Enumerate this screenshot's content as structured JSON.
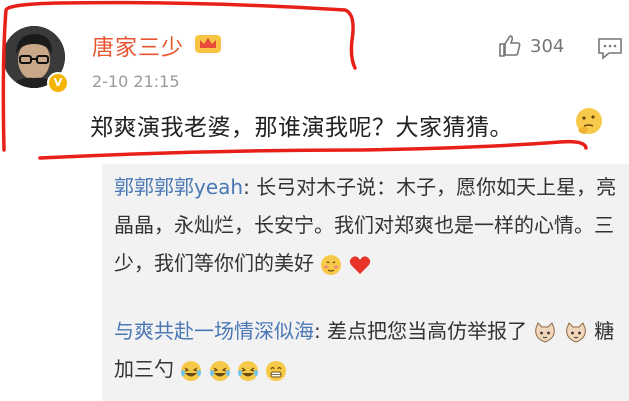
{
  "post": {
    "username": "唐家三少",
    "time": "2-10 21:15",
    "likes": "304",
    "text": "郑爽演我老婆，那谁演我呢？大家猜猜。",
    "icons": [
      "avatar",
      "vip-crown-icon",
      "verified-badge-icon",
      "like-icon",
      "comment-icon",
      "thinking-emoji-icon"
    ]
  },
  "replies": [
    {
      "name": "郭郭郭郭yeah",
      "colon": ":",
      "text": "长弓对木子说：木子，愿你如天上星，亮晶晶，永灿烂，长安宁。我们对郑爽也是一样的心情。三少，我们等你们的美好",
      "emojis": [
        "blush-emoji-icon",
        "heart-icon"
      ]
    },
    {
      "name": "与爽共赴一场情深似海",
      "colon": ":",
      "text": "差点把您当高仿举报了",
      "text2": "糖加三勺",
      "emojis": [
        "cat-emoji-icon",
        "cat-emoji-icon",
        "laugh-emoji-icon",
        "laugh-emoji-icon",
        "laugh-emoji-icon",
        "grin-emoji-icon"
      ]
    }
  ],
  "colors": {
    "username": "#e8542f",
    "reply_name": "#4a78b5",
    "annotation_red": "#e8201a",
    "reply_bg": "#f2f2f2"
  }
}
